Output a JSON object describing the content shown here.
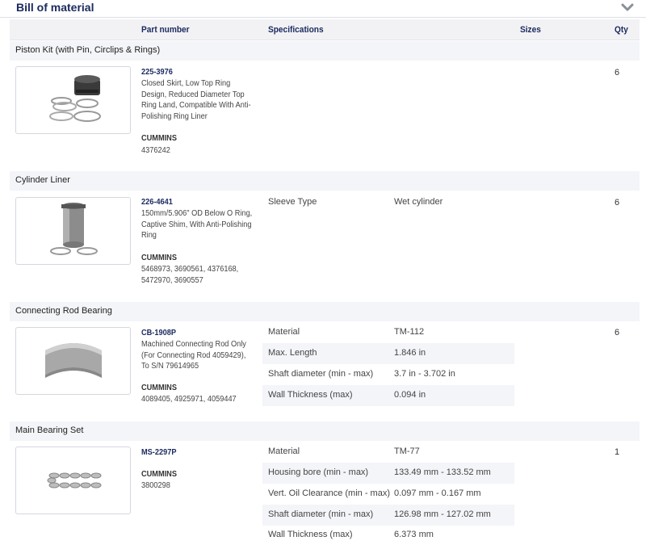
{
  "header": {
    "title": "Bill of material"
  },
  "columns": {
    "part": "Part number",
    "specifications": "Specifications",
    "sizes": "Sizes",
    "qty": "Qty"
  },
  "items": [
    {
      "section": "Piston Kit (with Pin, Circlips & Rings)",
      "part_number": "225-3976",
      "description": "Closed Skirt, Low Top Ring Design, Reduced Diameter Top Ring Land, Compatible With Anti-Polishing Ring Liner",
      "brand": "CUMMINS",
      "references": "4376242",
      "qty": "6",
      "specs": []
    },
    {
      "section": "Cylinder Liner",
      "part_number": "226-4641",
      "description": "150mm/5.906\" OD Below O Ring, Captive Shim, With Anti-Polishing Ring",
      "brand": "CUMMINS",
      "references": "5468973, 3690561, 4376168, 5472970, 3690557",
      "qty": "6",
      "specs": [
        {
          "name": "Sleeve Type",
          "value": "Wet cylinder"
        }
      ]
    },
    {
      "section": "Connecting Rod Bearing",
      "part_number": "CB-1908P",
      "description": "Machined Connecting Rod Only (For Connecting Rod 4059429), To S/N 79614965",
      "brand": "CUMMINS",
      "references": "4089405, 4925971, 4059447",
      "qty": "6",
      "specs": [
        {
          "name": "Material",
          "value": "TM-112"
        },
        {
          "name": "Max. Length",
          "value": "1.846 in"
        },
        {
          "name": "Shaft diameter (min - max)",
          "value": "3.7 in - 3.702 in"
        },
        {
          "name": "Wall Thickness (max)",
          "value": "0.094 in"
        }
      ]
    },
    {
      "section": "Main Bearing Set",
      "part_number": "MS-2297P",
      "description": "",
      "brand": "CUMMINS",
      "references": "3800298",
      "qty": "1",
      "specs": [
        {
          "name": "Material",
          "value": "TM-77"
        },
        {
          "name": "Housing bore (min - max)",
          "value": "133.49 mm - 133.52 mm"
        },
        {
          "name": "Vert. Oil Clearance (min - max)",
          "value": "0.097 mm - 0.167 mm"
        },
        {
          "name": "Shaft diameter (min - max)",
          "value": "126.98 mm - 127.02 mm"
        },
        {
          "name": "Wall Thickness (max)",
          "value": "6.373 mm"
        }
      ]
    }
  ]
}
